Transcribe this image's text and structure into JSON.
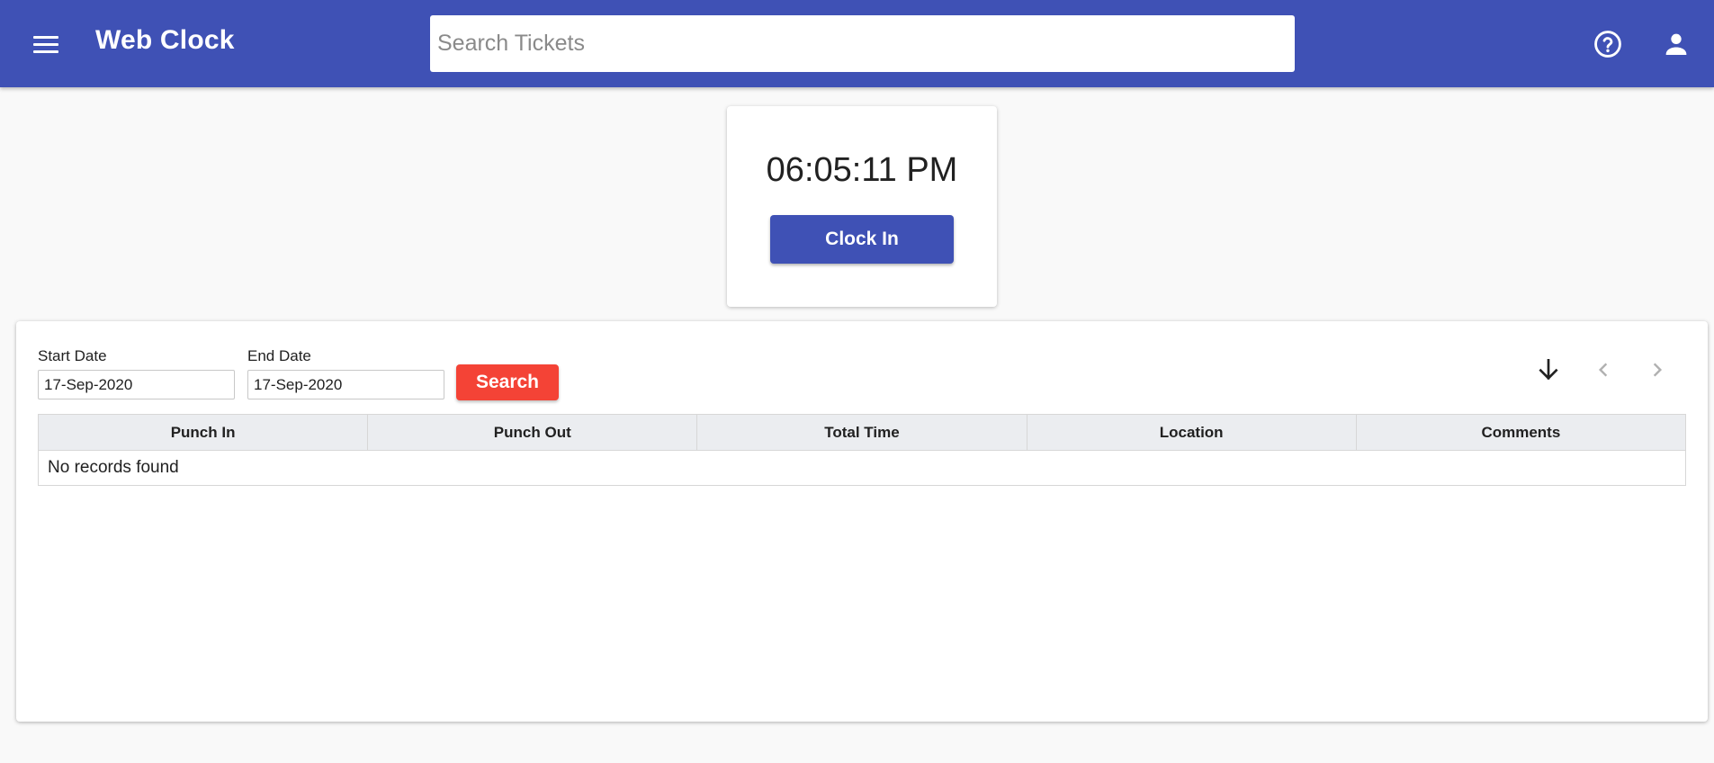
{
  "app": {
    "title": "Web Clock"
  },
  "header": {
    "search_placeholder": "Search Tickets",
    "search_value": "",
    "icons": {
      "menu": "menu-icon",
      "help": "help-circle-icon",
      "user": "account-icon"
    }
  },
  "clock": {
    "time": "06:05:11 PM",
    "button_label": "Clock In"
  },
  "filters": {
    "start_label": "Start Date",
    "start_value": "17-Sep-2020",
    "end_label": "End Date",
    "end_value": "17-Sep-2020",
    "search_label": "Search"
  },
  "table": {
    "columns": [
      "Punch In",
      "Punch Out",
      "Total Time",
      "Location",
      "Comments"
    ],
    "empty_message": "No records found"
  },
  "colors": {
    "primary": "#3f51b5",
    "accent": "#f44336"
  }
}
